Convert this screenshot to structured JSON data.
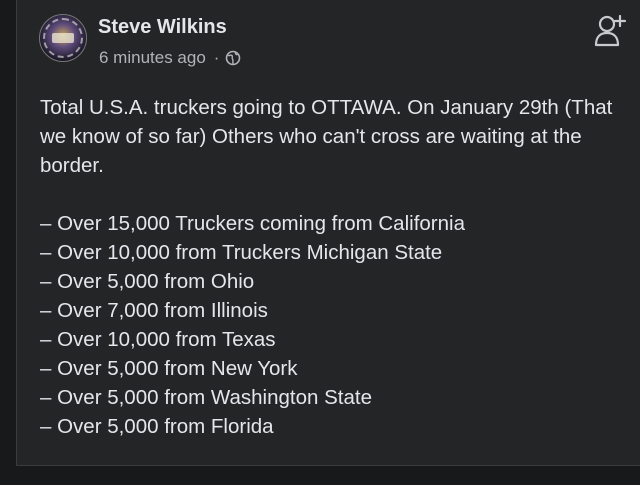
{
  "post": {
    "author": "Steve Wilkins",
    "timestamp": "6 minutes ago",
    "separator": "·",
    "privacy_icon": "globe-icon",
    "follow_icon": "add-friend-icon",
    "intro": "Total U.S.A. truckers going to OTTAWA. On January 29th (That we know of so far) Others who can't cross are waiting at the border.",
    "items": [
      "– Over 15,000 Truckers coming from California",
      "– Over 10,000 from Truckers Michigan State",
      "– Over 5,000 from Ohio",
      "– Over 7,000 from Illinois",
      "– Over 10,000 from Texas",
      "– Over 5,000 from New York",
      "– Over 5,000 from Washington State",
      "– Over 5,000 from Florida"
    ]
  },
  "colors": {
    "background": "#18191a",
    "card": "#242526",
    "primary_text": "#e4e6eb",
    "secondary_text": "#b0b3b8"
  }
}
